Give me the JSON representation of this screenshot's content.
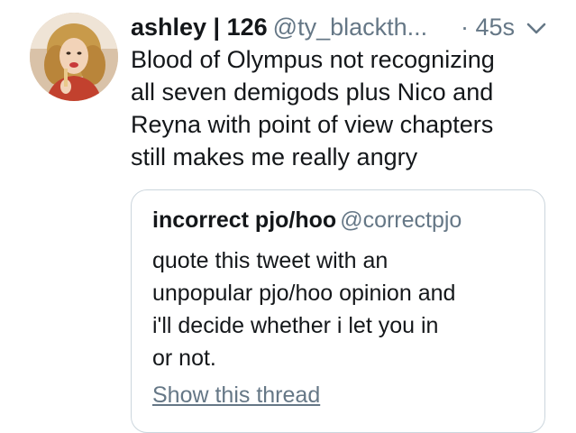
{
  "tweet": {
    "display_name": "ashley | 126",
    "handle": "@ty_blackth...",
    "time": "· 45s",
    "body_lines": [
      "Blood of Olympus not recognizing",
      "all seven demigods plus Nico and",
      "Reyna with point of view chapters",
      "still makes me really angry"
    ],
    "avatar_icon": "user-avatar",
    "caret_icon": "chevron-down-icon"
  },
  "quoted_tweet": {
    "display_name": "incorrect pjo/hoo",
    "handle": "@correctpjo",
    "body_lines": [
      "quote this tweet with an",
      "unpopular pjo/hoo opinion and",
      "i'll decide whether i let you in",
      "or not."
    ],
    "thread_link": "Show this thread"
  },
  "colors": {
    "text_primary": "#14171a",
    "text_secondary": "#657786",
    "border": "#ccd6dd"
  }
}
